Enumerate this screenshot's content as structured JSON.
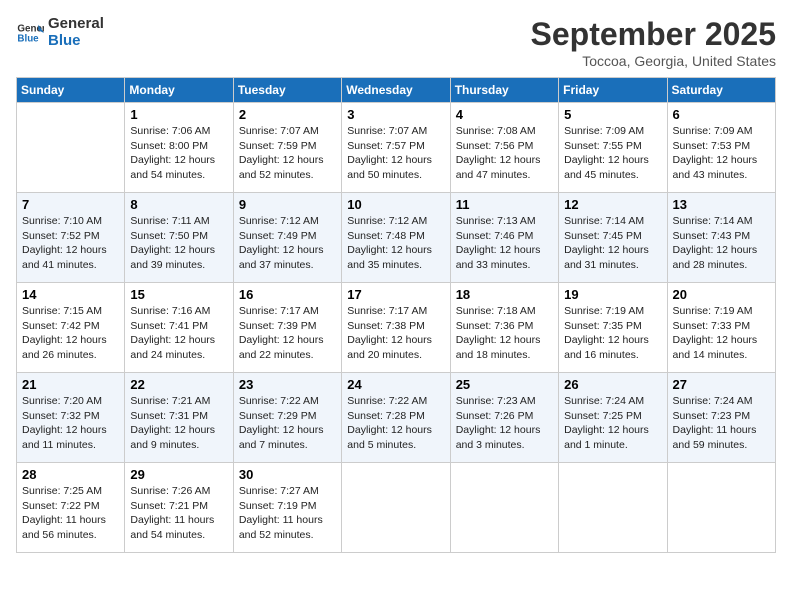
{
  "logo": {
    "line1": "General",
    "line2": "Blue"
  },
  "title": "September 2025",
  "location": "Toccoa, Georgia, United States",
  "days_of_week": [
    "Sunday",
    "Monday",
    "Tuesday",
    "Wednesday",
    "Thursday",
    "Friday",
    "Saturday"
  ],
  "weeks": [
    [
      {
        "day": "",
        "info": ""
      },
      {
        "day": "1",
        "info": "Sunrise: 7:06 AM\nSunset: 8:00 PM\nDaylight: 12 hours\nand 54 minutes."
      },
      {
        "day": "2",
        "info": "Sunrise: 7:07 AM\nSunset: 7:59 PM\nDaylight: 12 hours\nand 52 minutes."
      },
      {
        "day": "3",
        "info": "Sunrise: 7:07 AM\nSunset: 7:57 PM\nDaylight: 12 hours\nand 50 minutes."
      },
      {
        "day": "4",
        "info": "Sunrise: 7:08 AM\nSunset: 7:56 PM\nDaylight: 12 hours\nand 47 minutes."
      },
      {
        "day": "5",
        "info": "Sunrise: 7:09 AM\nSunset: 7:55 PM\nDaylight: 12 hours\nand 45 minutes."
      },
      {
        "day": "6",
        "info": "Sunrise: 7:09 AM\nSunset: 7:53 PM\nDaylight: 12 hours\nand 43 minutes."
      }
    ],
    [
      {
        "day": "7",
        "info": "Sunrise: 7:10 AM\nSunset: 7:52 PM\nDaylight: 12 hours\nand 41 minutes."
      },
      {
        "day": "8",
        "info": "Sunrise: 7:11 AM\nSunset: 7:50 PM\nDaylight: 12 hours\nand 39 minutes."
      },
      {
        "day": "9",
        "info": "Sunrise: 7:12 AM\nSunset: 7:49 PM\nDaylight: 12 hours\nand 37 minutes."
      },
      {
        "day": "10",
        "info": "Sunrise: 7:12 AM\nSunset: 7:48 PM\nDaylight: 12 hours\nand 35 minutes."
      },
      {
        "day": "11",
        "info": "Sunrise: 7:13 AM\nSunset: 7:46 PM\nDaylight: 12 hours\nand 33 minutes."
      },
      {
        "day": "12",
        "info": "Sunrise: 7:14 AM\nSunset: 7:45 PM\nDaylight: 12 hours\nand 31 minutes."
      },
      {
        "day": "13",
        "info": "Sunrise: 7:14 AM\nSunset: 7:43 PM\nDaylight: 12 hours\nand 28 minutes."
      }
    ],
    [
      {
        "day": "14",
        "info": "Sunrise: 7:15 AM\nSunset: 7:42 PM\nDaylight: 12 hours\nand 26 minutes."
      },
      {
        "day": "15",
        "info": "Sunrise: 7:16 AM\nSunset: 7:41 PM\nDaylight: 12 hours\nand 24 minutes."
      },
      {
        "day": "16",
        "info": "Sunrise: 7:17 AM\nSunset: 7:39 PM\nDaylight: 12 hours\nand 22 minutes."
      },
      {
        "day": "17",
        "info": "Sunrise: 7:17 AM\nSunset: 7:38 PM\nDaylight: 12 hours\nand 20 minutes."
      },
      {
        "day": "18",
        "info": "Sunrise: 7:18 AM\nSunset: 7:36 PM\nDaylight: 12 hours\nand 18 minutes."
      },
      {
        "day": "19",
        "info": "Sunrise: 7:19 AM\nSunset: 7:35 PM\nDaylight: 12 hours\nand 16 minutes."
      },
      {
        "day": "20",
        "info": "Sunrise: 7:19 AM\nSunset: 7:33 PM\nDaylight: 12 hours\nand 14 minutes."
      }
    ],
    [
      {
        "day": "21",
        "info": "Sunrise: 7:20 AM\nSunset: 7:32 PM\nDaylight: 12 hours\nand 11 minutes."
      },
      {
        "day": "22",
        "info": "Sunrise: 7:21 AM\nSunset: 7:31 PM\nDaylight: 12 hours\nand 9 minutes."
      },
      {
        "day": "23",
        "info": "Sunrise: 7:22 AM\nSunset: 7:29 PM\nDaylight: 12 hours\nand 7 minutes."
      },
      {
        "day": "24",
        "info": "Sunrise: 7:22 AM\nSunset: 7:28 PM\nDaylight: 12 hours\nand 5 minutes."
      },
      {
        "day": "25",
        "info": "Sunrise: 7:23 AM\nSunset: 7:26 PM\nDaylight: 12 hours\nand 3 minutes."
      },
      {
        "day": "26",
        "info": "Sunrise: 7:24 AM\nSunset: 7:25 PM\nDaylight: 12 hours\nand 1 minute."
      },
      {
        "day": "27",
        "info": "Sunrise: 7:24 AM\nSunset: 7:23 PM\nDaylight: 11 hours\nand 59 minutes."
      }
    ],
    [
      {
        "day": "28",
        "info": "Sunrise: 7:25 AM\nSunset: 7:22 PM\nDaylight: 11 hours\nand 56 minutes."
      },
      {
        "day": "29",
        "info": "Sunrise: 7:26 AM\nSunset: 7:21 PM\nDaylight: 11 hours\nand 54 minutes."
      },
      {
        "day": "30",
        "info": "Sunrise: 7:27 AM\nSunset: 7:19 PM\nDaylight: 11 hours\nand 52 minutes."
      },
      {
        "day": "",
        "info": ""
      },
      {
        "day": "",
        "info": ""
      },
      {
        "day": "",
        "info": ""
      },
      {
        "day": "",
        "info": ""
      }
    ]
  ]
}
